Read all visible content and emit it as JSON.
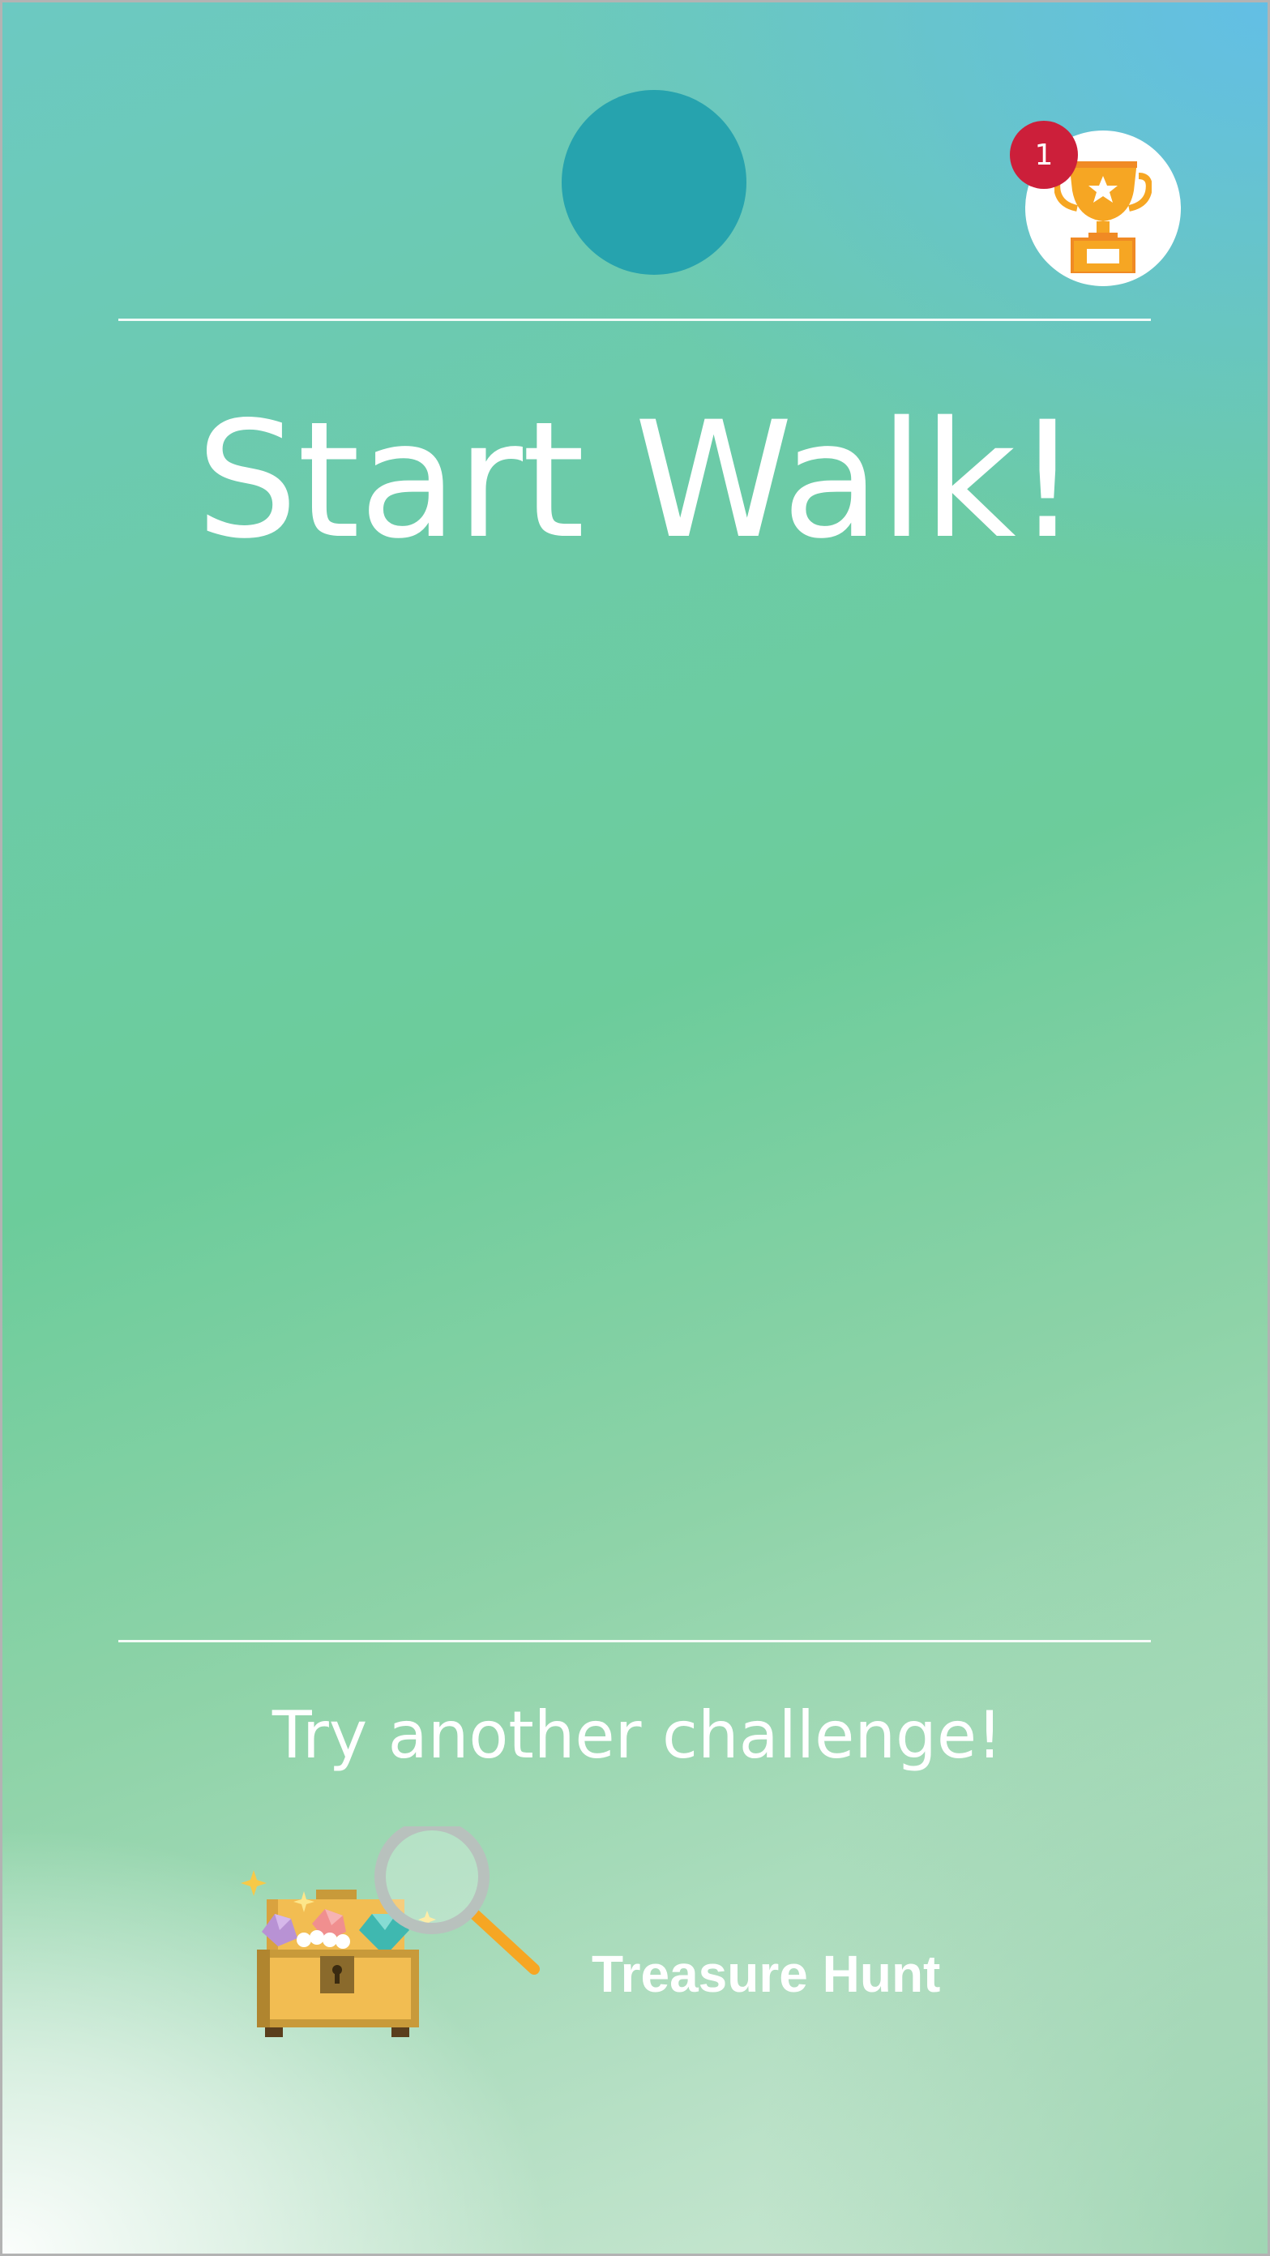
{
  "header": {
    "notification_count": "1",
    "trophy_icon": "trophy-icon",
    "profile_circle_color": "#26a3ae"
  },
  "main": {
    "title": "Start Walk!"
  },
  "footer": {
    "prompt": "Try another challenge!",
    "challenges": [
      {
        "label": "Treasure Hunt",
        "icon": "treasure-chest-icon"
      }
    ]
  },
  "colors": {
    "badge": "#cc1f3a",
    "text": "#ffffff"
  }
}
